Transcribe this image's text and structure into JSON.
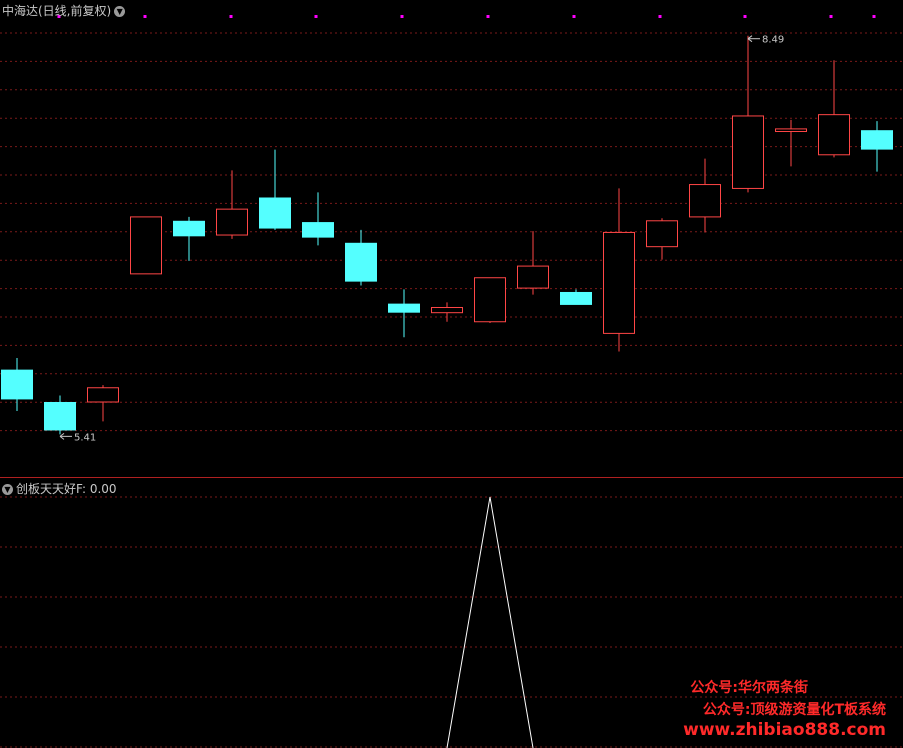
{
  "header": {
    "stock_title": "中海达(日线,前复权)",
    "indicator_label": "创板天天好F",
    "indicator_value": ": 0.00"
  },
  "watermark": {
    "line1": "公众号:华尔两条街",
    "line2": "公众号:顶级游资量化T板系统",
    "line3": "www.zhibiao888.com"
  },
  "colors": {
    "background": "#000000",
    "up": "#ff4646",
    "down": "#54ffff",
    "grid": "#7a1a1a",
    "divider": "#b02020",
    "indicator_line": "#ffffff",
    "marker": "#ff00ff",
    "watermark": "#ff2a2a"
  },
  "chart_data": [
    {
      "type": "candlestick",
      "title": "中海达(日线,前复权)",
      "ylim": [
        5.15,
        8.65
      ],
      "annotations": [
        {
          "label": "8.49",
          "value": 8.49,
          "candle_index": 17
        },
        {
          "label": "5.41",
          "value": 5.41,
          "candle_index": 1
        }
      ],
      "candles": [
        {
          "open": 5.91,
          "high": 6.0,
          "low": 5.59,
          "close": 5.68
        },
        {
          "open": 5.66,
          "high": 5.71,
          "low": 5.41,
          "close": 5.44
        },
        {
          "open": 5.66,
          "high": 5.79,
          "low": 5.51,
          "close": 5.77
        },
        {
          "open": 6.65,
          "high": 6.95,
          "low": 6.65,
          "close": 7.09
        },
        {
          "open": 7.06,
          "high": 7.09,
          "low": 6.75,
          "close": 6.94
        },
        {
          "open": 6.95,
          "high": 7.45,
          "low": 6.92,
          "close": 7.15
        },
        {
          "open": 7.24,
          "high": 7.61,
          "low": 6.99,
          "close": 7.0
        },
        {
          "open": 7.05,
          "high": 7.28,
          "low": 6.87,
          "close": 6.93
        },
        {
          "open": 6.89,
          "high": 6.99,
          "low": 6.56,
          "close": 6.59
        },
        {
          "open": 6.42,
          "high": 6.53,
          "low": 6.16,
          "close": 6.35
        },
        {
          "open": 6.35,
          "high": 6.43,
          "low": 6.28,
          "close": 6.39
        },
        {
          "open": 6.28,
          "high": 6.56,
          "low": 6.27,
          "close": 6.62
        },
        {
          "open": 6.54,
          "high": 6.98,
          "low": 6.49,
          "close": 6.71
        },
        {
          "open": 6.51,
          "high": 6.53,
          "low": 6.42,
          "close": 6.41
        },
        {
          "open": 6.19,
          "high": 7.31,
          "low": 6.05,
          "close": 6.97
        },
        {
          "open": 6.86,
          "high": 7.08,
          "low": 6.76,
          "close": 7.06
        },
        {
          "open": 7.09,
          "high": 7.54,
          "low": 6.97,
          "close": 7.34
        },
        {
          "open": 7.31,
          "high": 8.49,
          "low": 7.28,
          "close": 7.87
        },
        {
          "open": 7.75,
          "high": 7.84,
          "low": 7.48,
          "close": 7.77
        },
        {
          "open": 7.57,
          "high": 8.3,
          "low": 7.55,
          "close": 7.88
        },
        {
          "open": 7.76,
          "high": 7.83,
          "low": 7.44,
          "close": 7.61
        }
      ]
    },
    {
      "type": "line",
      "title": "创板天天好F",
      "x": [
        0,
        1,
        2,
        3,
        4,
        5,
        6,
        7,
        8,
        9,
        10,
        11,
        12,
        13,
        14,
        15,
        16,
        17,
        18,
        19,
        20
      ],
      "ylim": [
        0,
        1
      ],
      "series": [
        {
          "values": [
            0,
            0,
            0,
            0,
            0,
            0,
            0,
            0,
            0,
            0,
            0,
            1,
            0,
            0,
            0,
            0,
            0,
            0,
            0,
            0,
            0
          ]
        }
      ]
    }
  ]
}
